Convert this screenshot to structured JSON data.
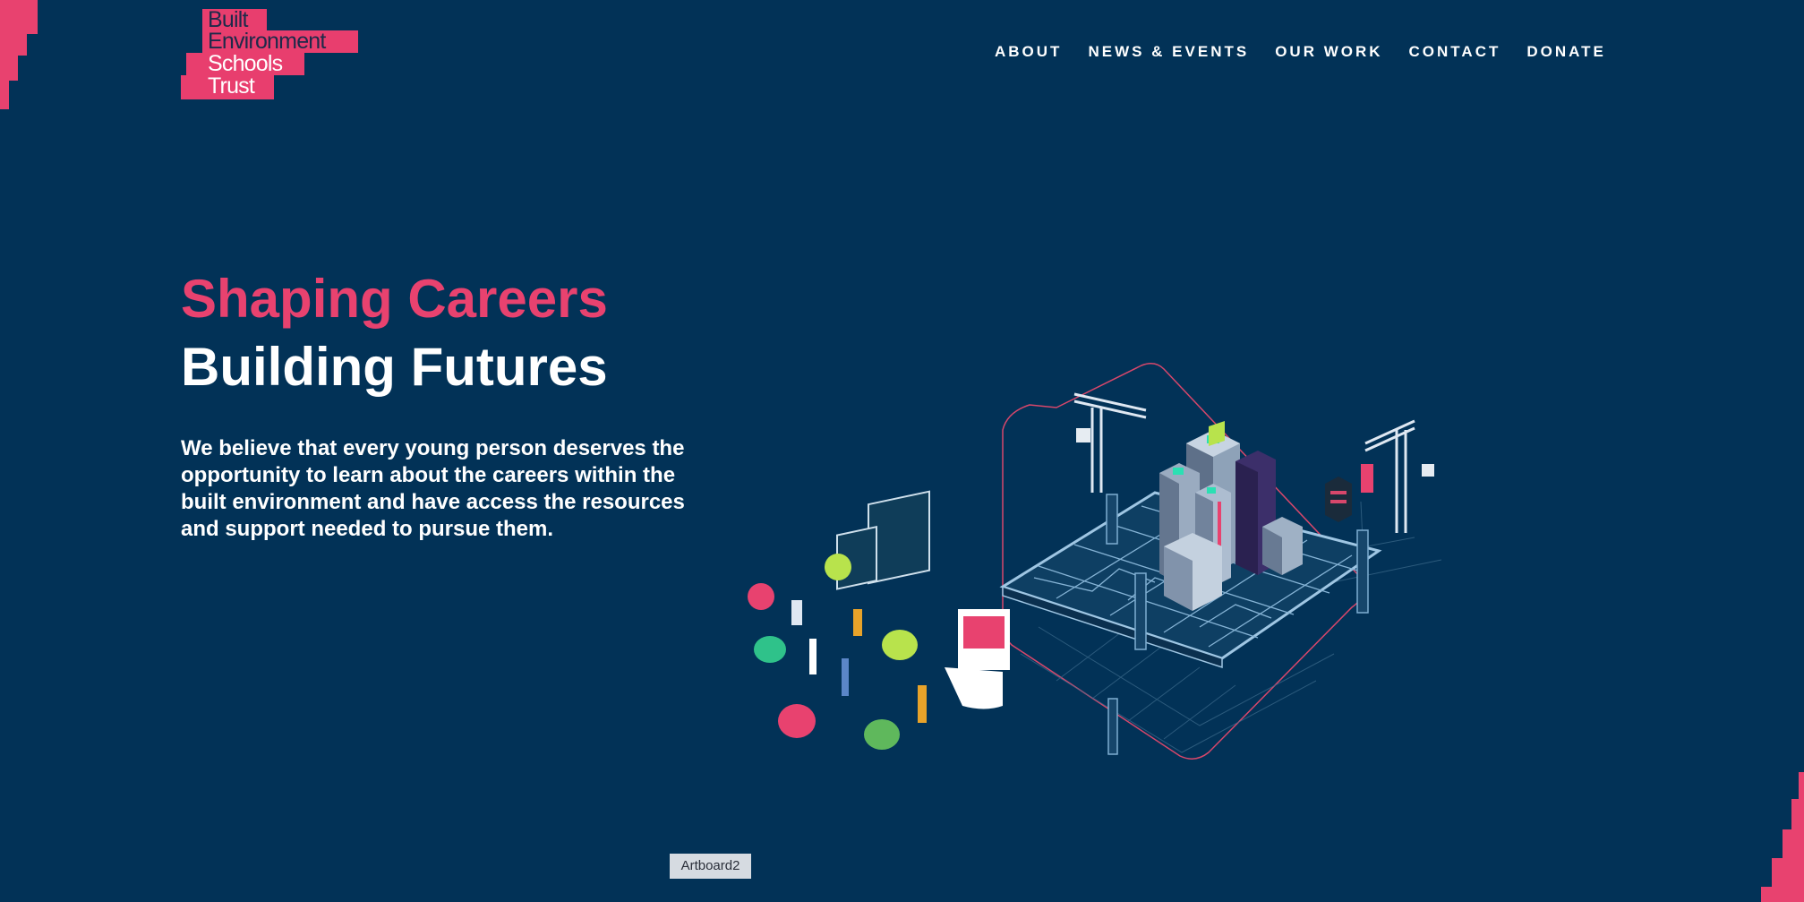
{
  "logo": {
    "lines": [
      "Built",
      "Environment",
      "Schools",
      "Trust"
    ]
  },
  "nav": {
    "items": [
      "ABOUT",
      "NEWS & EVENTS",
      "OUR WORK",
      "CONTACT",
      "DONATE"
    ]
  },
  "hero": {
    "title_line1": "Shaping Careers",
    "title_line2": "Building Futures",
    "body": "We believe that every young person deserves the opportunity to learn about the careers within the built environment and have access the resources and support needed to pursue them."
  },
  "illustration": {
    "icon": "isometric-city-illustration"
  },
  "artboard_label": "Artboard2",
  "colors": {
    "background": "#023257",
    "accent_pink": "#e8426f",
    "text": "#ffffff"
  }
}
